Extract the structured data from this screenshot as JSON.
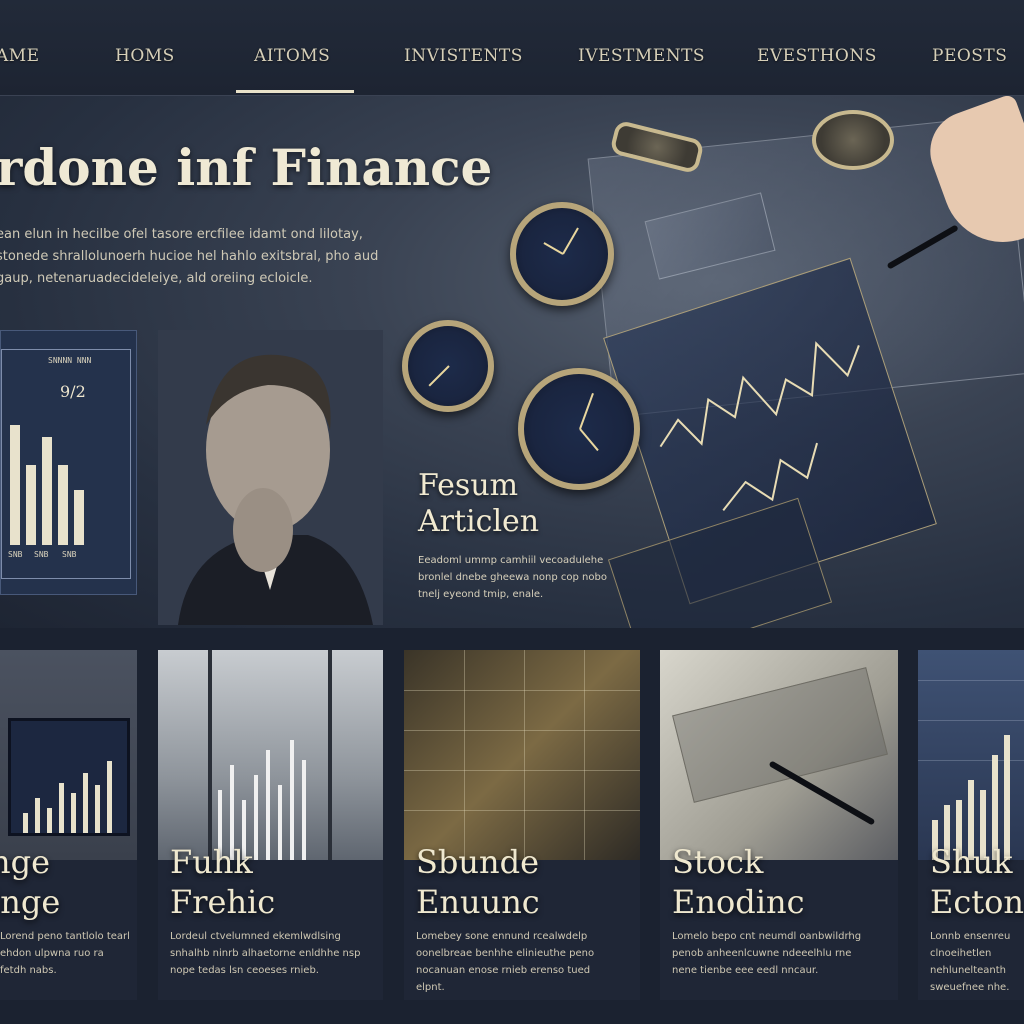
{
  "nav": {
    "items": [
      "AME",
      "HOMS",
      "AITOMS",
      "INVISTENTS",
      "IVESTMENTS",
      "EVESTHONS",
      "PEOSTS"
    ],
    "active_index": 2
  },
  "hero": {
    "title": "rdone inf Finance",
    "description": "ean elun in hecilbe ofel tasore ercfilee idamt ond lilotay, stonede shrallolunoerh hucioe hel hahlo exitsbral, pho aud gaup, netenaruadecideleiye, ald oreiing ecloicle."
  },
  "mini_chart": {
    "header": "SNNNN NNN",
    "value": "9/2",
    "axis_labels": [
      "SNB",
      "SNB",
      "SNB"
    ]
  },
  "featured": {
    "title_line1": "Fesum",
    "title_line2": "Articlen",
    "description": "Eeadoml ummp camhiil vecoadulehe bronlel dnebe gheewa nonp cop nobo tnelj eyeond tmip, enale."
  },
  "cards": [
    {
      "title_line1": "nge",
      "title_line2": "inge",
      "description": "Lorend peno tantlolo tearl ehdon ulpwna ruo ra fetdh nabs."
    },
    {
      "title_line1": "Fuhk",
      "title_line2": "Frehic",
      "description": "Lordeul ctvelumned ekemlwdlsing snhalhb ninrb alhaetorne enldhhe nsp nope tedas lsn ceoeses rnieb."
    },
    {
      "title_line1": "Sbunde",
      "title_line2": "Enuunc",
      "description": "Lomebey sone ennund rcealwdelp oonelbreae benhhe elinieuthe peno nocanuan enose rnieb erenso tued elpnt."
    },
    {
      "title_line1": "Stock",
      "title_line2": "Enodinc",
      "description": "Lomelo bepo cnt neumdl oanbwildrhg penob anheenlcuwne ndeeelhlu rne nene tienbe eee eedl nncaur."
    },
    {
      "title_line1": "Shuk",
      "title_line2": "Ecton",
      "description": "Lonnb ensenreu clnoeihetlen nehlunelteanth sweuefnee nhe."
    }
  ],
  "colors": {
    "background": "#1b2230",
    "accent": "#e9e2c9",
    "gold": "#b7a57a"
  }
}
